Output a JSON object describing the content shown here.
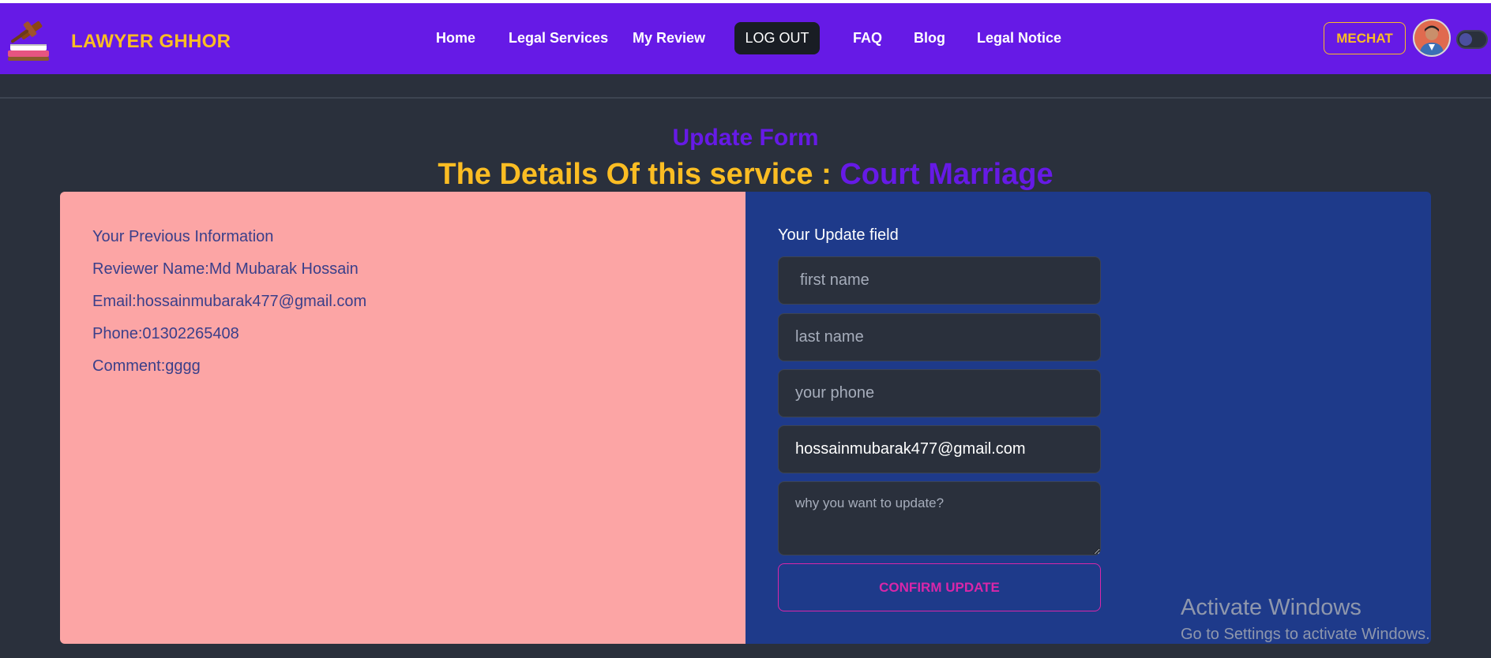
{
  "brand": {
    "name": "LAWYER GHHOR",
    "logo_icon": "gavel-books-icon"
  },
  "nav": {
    "home": "Home",
    "legal_services": "Legal Services",
    "my_review": "My Review",
    "logout": "LOG OUT",
    "faq": "FAQ",
    "blog": "Blog",
    "legal_notice": "Legal Notice"
  },
  "header_right": {
    "mechat": "MECHAT",
    "avatar_icon": "user-avatar",
    "toggle_icon": "theme-toggle-icon"
  },
  "page": {
    "form_title": "Update Form",
    "heading_prefix": "The Details Of this service : ",
    "service_name": "Court Marriage"
  },
  "previous_info": {
    "title": "Your Previous Information",
    "reviewer": "Reviewer Name:Md Mubarak Hossain",
    "email": "Email:hossainmubarak477@gmail.com",
    "phone": "Phone:01302265408",
    "comment": "Comment:gggg"
  },
  "update_form": {
    "label": "Your Update field",
    "first_name_placeholder": "first name",
    "last_name_placeholder": "last name",
    "phone_placeholder": "your phone",
    "email_value": "hossainmubarak477@gmail.com",
    "reason_placeholder": "why you want to update?",
    "confirm_label": "CONFIRM UPDATE"
  },
  "windows_watermark": {
    "title": "Activate Windows",
    "subtitle": "Go to Settings to activate Windows."
  },
  "colors": {
    "navbar": "#661ae6",
    "accent_yellow": "#fbbd23",
    "left_panel": "#fca5a5",
    "right_panel": "#1e3a8a",
    "confirm": "#d926a9",
    "background": "#2a303c"
  }
}
